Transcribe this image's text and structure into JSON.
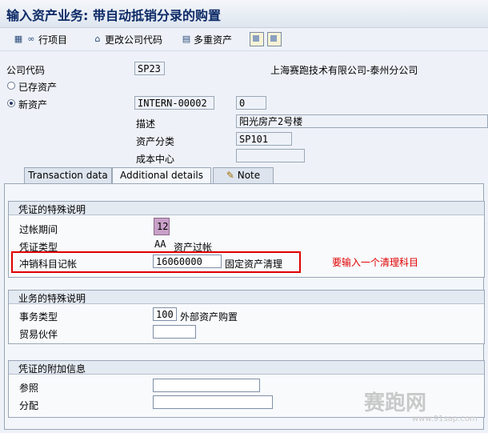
{
  "window": {
    "title": "输入资产业务: 带自动抵销分录的购置"
  },
  "toolbar": {
    "line_items": "行项目",
    "change_company_code": "更改公司代码",
    "multiple_assets": "多重资产"
  },
  "header": {
    "company_code_label": "公司代码",
    "company_code_value": "SP23",
    "company_name": "上海赛跑技术有限公司-泰州分公司",
    "existing_asset_label": "已存资产",
    "new_asset_label": "新资产",
    "asset_number": "INTERN-00002",
    "sub_number": "0",
    "description_label": "描述",
    "description_value": "阳光房产2号楼",
    "asset_class_label": "资产分类",
    "asset_class_value": "SP101",
    "cost_center_label": "成本中心",
    "cost_center_value": ""
  },
  "tabs": [
    {
      "label": "Transaction data"
    },
    {
      "label": "Additional details"
    },
    {
      "label": "Note"
    }
  ],
  "doc_special": {
    "title": "凭证的特殊说明",
    "posting_period_label": "过帐期间",
    "posting_period_value": "12",
    "doc_type_label": "凭证类型",
    "doc_type_value": "AA",
    "doc_type_text": "资产过帐",
    "offset_account_label": "冲销科目记帐",
    "offset_account_value": "16060000",
    "offset_account_text": "固定资产清理"
  },
  "annotation": {
    "text": "要输入一个清理科目"
  },
  "business_special": {
    "title": "业务的特殊说明",
    "transaction_type_label": "事务类型",
    "transaction_type_value": "100",
    "transaction_type_text": "外部资产购置",
    "trading_partner_label": "贸易伙伴",
    "trading_partner_value": ""
  },
  "doc_additional": {
    "title": "凭证的附加信息",
    "reference_label": "参照",
    "reference_value": "",
    "assignment_label": "分配",
    "assignment_value": ""
  },
  "watermark": {
    "logo_text": "赛跑网",
    "url": "www.91sap.com"
  },
  "colors": {
    "highlight": "#e00000",
    "title": "#0c2a66",
    "marker": "#c9a0c8"
  }
}
